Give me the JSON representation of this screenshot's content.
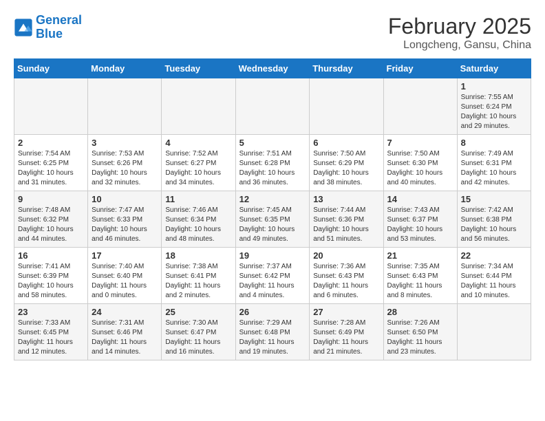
{
  "logo": {
    "line1": "General",
    "line2": "Blue"
  },
  "title": "February 2025",
  "subtitle": "Longcheng, Gansu, China",
  "weekdays": [
    "Sunday",
    "Monday",
    "Tuesday",
    "Wednesday",
    "Thursday",
    "Friday",
    "Saturday"
  ],
  "weeks": [
    [
      {
        "day": "",
        "info": ""
      },
      {
        "day": "",
        "info": ""
      },
      {
        "day": "",
        "info": ""
      },
      {
        "day": "",
        "info": ""
      },
      {
        "day": "",
        "info": ""
      },
      {
        "day": "",
        "info": ""
      },
      {
        "day": "1",
        "info": "Sunrise: 7:55 AM\nSunset: 6:24 PM\nDaylight: 10 hours and 29 minutes."
      }
    ],
    [
      {
        "day": "2",
        "info": "Sunrise: 7:54 AM\nSunset: 6:25 PM\nDaylight: 10 hours and 31 minutes."
      },
      {
        "day": "3",
        "info": "Sunrise: 7:53 AM\nSunset: 6:26 PM\nDaylight: 10 hours and 32 minutes."
      },
      {
        "day": "4",
        "info": "Sunrise: 7:52 AM\nSunset: 6:27 PM\nDaylight: 10 hours and 34 minutes."
      },
      {
        "day": "5",
        "info": "Sunrise: 7:51 AM\nSunset: 6:28 PM\nDaylight: 10 hours and 36 minutes."
      },
      {
        "day": "6",
        "info": "Sunrise: 7:50 AM\nSunset: 6:29 PM\nDaylight: 10 hours and 38 minutes."
      },
      {
        "day": "7",
        "info": "Sunrise: 7:50 AM\nSunset: 6:30 PM\nDaylight: 10 hours and 40 minutes."
      },
      {
        "day": "8",
        "info": "Sunrise: 7:49 AM\nSunset: 6:31 PM\nDaylight: 10 hours and 42 minutes."
      }
    ],
    [
      {
        "day": "9",
        "info": "Sunrise: 7:48 AM\nSunset: 6:32 PM\nDaylight: 10 hours and 44 minutes."
      },
      {
        "day": "10",
        "info": "Sunrise: 7:47 AM\nSunset: 6:33 PM\nDaylight: 10 hours and 46 minutes."
      },
      {
        "day": "11",
        "info": "Sunrise: 7:46 AM\nSunset: 6:34 PM\nDaylight: 10 hours and 48 minutes."
      },
      {
        "day": "12",
        "info": "Sunrise: 7:45 AM\nSunset: 6:35 PM\nDaylight: 10 hours and 49 minutes."
      },
      {
        "day": "13",
        "info": "Sunrise: 7:44 AM\nSunset: 6:36 PM\nDaylight: 10 hours and 51 minutes."
      },
      {
        "day": "14",
        "info": "Sunrise: 7:43 AM\nSunset: 6:37 PM\nDaylight: 10 hours and 53 minutes."
      },
      {
        "day": "15",
        "info": "Sunrise: 7:42 AM\nSunset: 6:38 PM\nDaylight: 10 hours and 56 minutes."
      }
    ],
    [
      {
        "day": "16",
        "info": "Sunrise: 7:41 AM\nSunset: 6:39 PM\nDaylight: 10 hours and 58 minutes."
      },
      {
        "day": "17",
        "info": "Sunrise: 7:40 AM\nSunset: 6:40 PM\nDaylight: 11 hours and 0 minutes."
      },
      {
        "day": "18",
        "info": "Sunrise: 7:38 AM\nSunset: 6:41 PM\nDaylight: 11 hours and 2 minutes."
      },
      {
        "day": "19",
        "info": "Sunrise: 7:37 AM\nSunset: 6:42 PM\nDaylight: 11 hours and 4 minutes."
      },
      {
        "day": "20",
        "info": "Sunrise: 7:36 AM\nSunset: 6:43 PM\nDaylight: 11 hours and 6 minutes."
      },
      {
        "day": "21",
        "info": "Sunrise: 7:35 AM\nSunset: 6:43 PM\nDaylight: 11 hours and 8 minutes."
      },
      {
        "day": "22",
        "info": "Sunrise: 7:34 AM\nSunset: 6:44 PM\nDaylight: 11 hours and 10 minutes."
      }
    ],
    [
      {
        "day": "23",
        "info": "Sunrise: 7:33 AM\nSunset: 6:45 PM\nDaylight: 11 hours and 12 minutes."
      },
      {
        "day": "24",
        "info": "Sunrise: 7:31 AM\nSunset: 6:46 PM\nDaylight: 11 hours and 14 minutes."
      },
      {
        "day": "25",
        "info": "Sunrise: 7:30 AM\nSunset: 6:47 PM\nDaylight: 11 hours and 16 minutes."
      },
      {
        "day": "26",
        "info": "Sunrise: 7:29 AM\nSunset: 6:48 PM\nDaylight: 11 hours and 19 minutes."
      },
      {
        "day": "27",
        "info": "Sunrise: 7:28 AM\nSunset: 6:49 PM\nDaylight: 11 hours and 21 minutes."
      },
      {
        "day": "28",
        "info": "Sunrise: 7:26 AM\nSunset: 6:50 PM\nDaylight: 11 hours and 23 minutes."
      },
      {
        "day": "",
        "info": ""
      }
    ]
  ]
}
